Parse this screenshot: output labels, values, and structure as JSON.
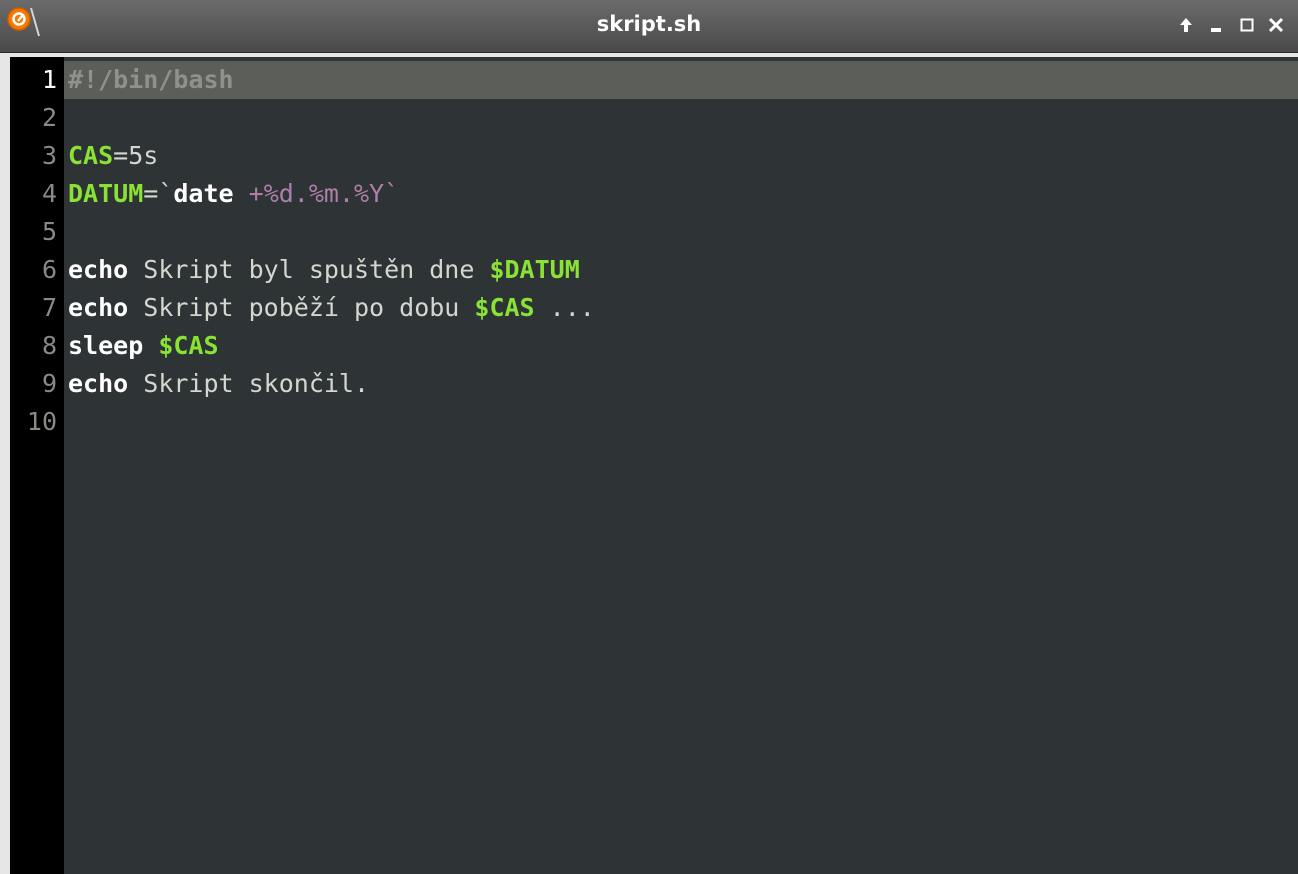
{
  "window": {
    "title": "skript.sh",
    "app_icon": "app-logo-icon",
    "controls": [
      "keep-above-icon",
      "minimize-icon",
      "maximize-icon",
      "close-icon"
    ]
  },
  "colors": {
    "background": "#2e3436",
    "gutter": "#000000",
    "current_line": "#5c5e5a",
    "variable": "#8ae234",
    "keyword": "#ffffff",
    "string_arg": "#ad7fa8",
    "comment": "#8f928c",
    "text": "#d3d7cf"
  },
  "editor": {
    "current_line": 1,
    "lines": [
      {
        "number": "1",
        "tokens": [
          {
            "text": "#!/bin/bash",
            "kind": "comment"
          }
        ]
      },
      {
        "number": "2",
        "tokens": []
      },
      {
        "number": "3",
        "tokens": [
          {
            "text": "CAS",
            "kind": "var"
          },
          {
            "text": "=5s",
            "kind": "normal"
          }
        ]
      },
      {
        "number": "4",
        "tokens": [
          {
            "text": "DATUM",
            "kind": "var"
          },
          {
            "text": "=`",
            "kind": "normal"
          },
          {
            "text": "date",
            "kind": "kw"
          },
          {
            "text": " +%d.%m.%Y`",
            "kind": "magenta"
          }
        ]
      },
      {
        "number": "5",
        "tokens": []
      },
      {
        "number": "6",
        "tokens": [
          {
            "text": "echo",
            "kind": "kw"
          },
          {
            "text": " Skript byl spuštěn dne ",
            "kind": "normal"
          },
          {
            "text": "$DATUM",
            "kind": "var"
          }
        ]
      },
      {
        "number": "7",
        "tokens": [
          {
            "text": "echo",
            "kind": "kw"
          },
          {
            "text": " Skript poběží po dobu ",
            "kind": "normal"
          },
          {
            "text": "$CAS",
            "kind": "var"
          },
          {
            "text": " ...",
            "kind": "normal"
          }
        ]
      },
      {
        "number": "8",
        "tokens": [
          {
            "text": "sleep",
            "kind": "kw"
          },
          {
            "text": " ",
            "kind": "normal"
          },
          {
            "text": "$CAS",
            "kind": "var"
          }
        ]
      },
      {
        "number": "9",
        "tokens": [
          {
            "text": "echo",
            "kind": "kw"
          },
          {
            "text": " Skript skončil.",
            "kind": "normal"
          }
        ]
      },
      {
        "number": "10",
        "tokens": []
      }
    ]
  }
}
